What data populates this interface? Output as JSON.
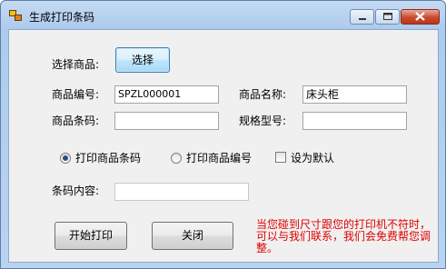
{
  "window": {
    "title": "生成打印条码"
  },
  "form": {
    "select_product_label": "选择商品:",
    "select_button": "选择",
    "product_code_label": "商品编号:",
    "product_code_value": "SPZL000001",
    "product_name_label": "商品名称:",
    "product_name_value": "床头柜",
    "barcode_label": "商品条码:",
    "barcode_value": "",
    "spec_label": "规格型号:",
    "spec_value": "",
    "print_barcode_option": "打印商品条码",
    "print_code_option": "打印商品编号",
    "set_default_label": "设为默认",
    "selected_option": "打印商品条码",
    "barcode_content_label": "条码内容:",
    "barcode_content_value": ""
  },
  "actions": {
    "print_button": "开始打印",
    "close_button": "关闭"
  },
  "notice": "当您碰到尺寸跟您的打印机不符时，可以与我们联系，我们会免费帮您调整。",
  "colors": {
    "notice": "#e00000",
    "titlebar": "#b9d3f1"
  }
}
